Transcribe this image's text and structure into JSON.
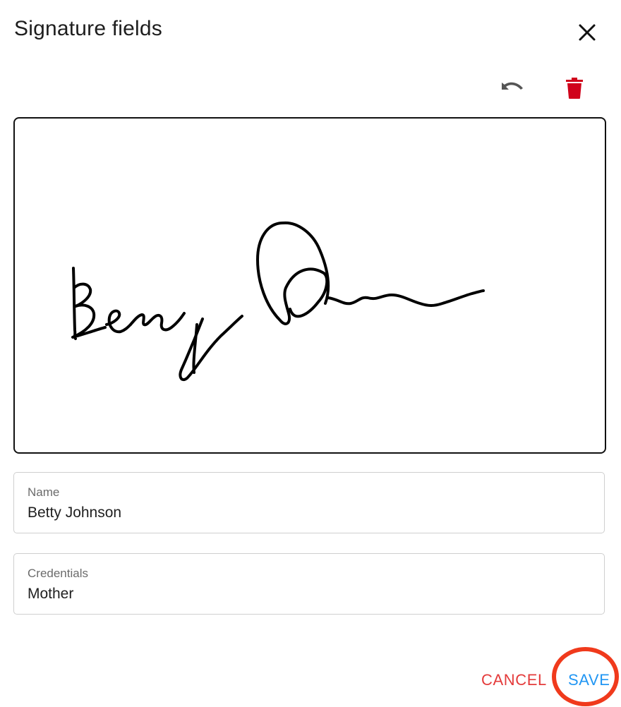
{
  "dialog": {
    "title": "Signature fields"
  },
  "toolbar": {
    "undo_icon": "undo-icon",
    "delete_icon": "trash-icon",
    "delete_color": "#d0021b",
    "undo_color": "#555555"
  },
  "fields": {
    "name": {
      "label": "Name",
      "value": "Betty Johnson"
    },
    "credentials": {
      "label": "Credentials",
      "value": "Mother"
    }
  },
  "actions": {
    "cancel_label": "CANCEL",
    "save_label": "SAVE",
    "cancel_color": "#e43b3b",
    "save_color": "#2196f3",
    "highlight_color": "#f03a1c"
  }
}
